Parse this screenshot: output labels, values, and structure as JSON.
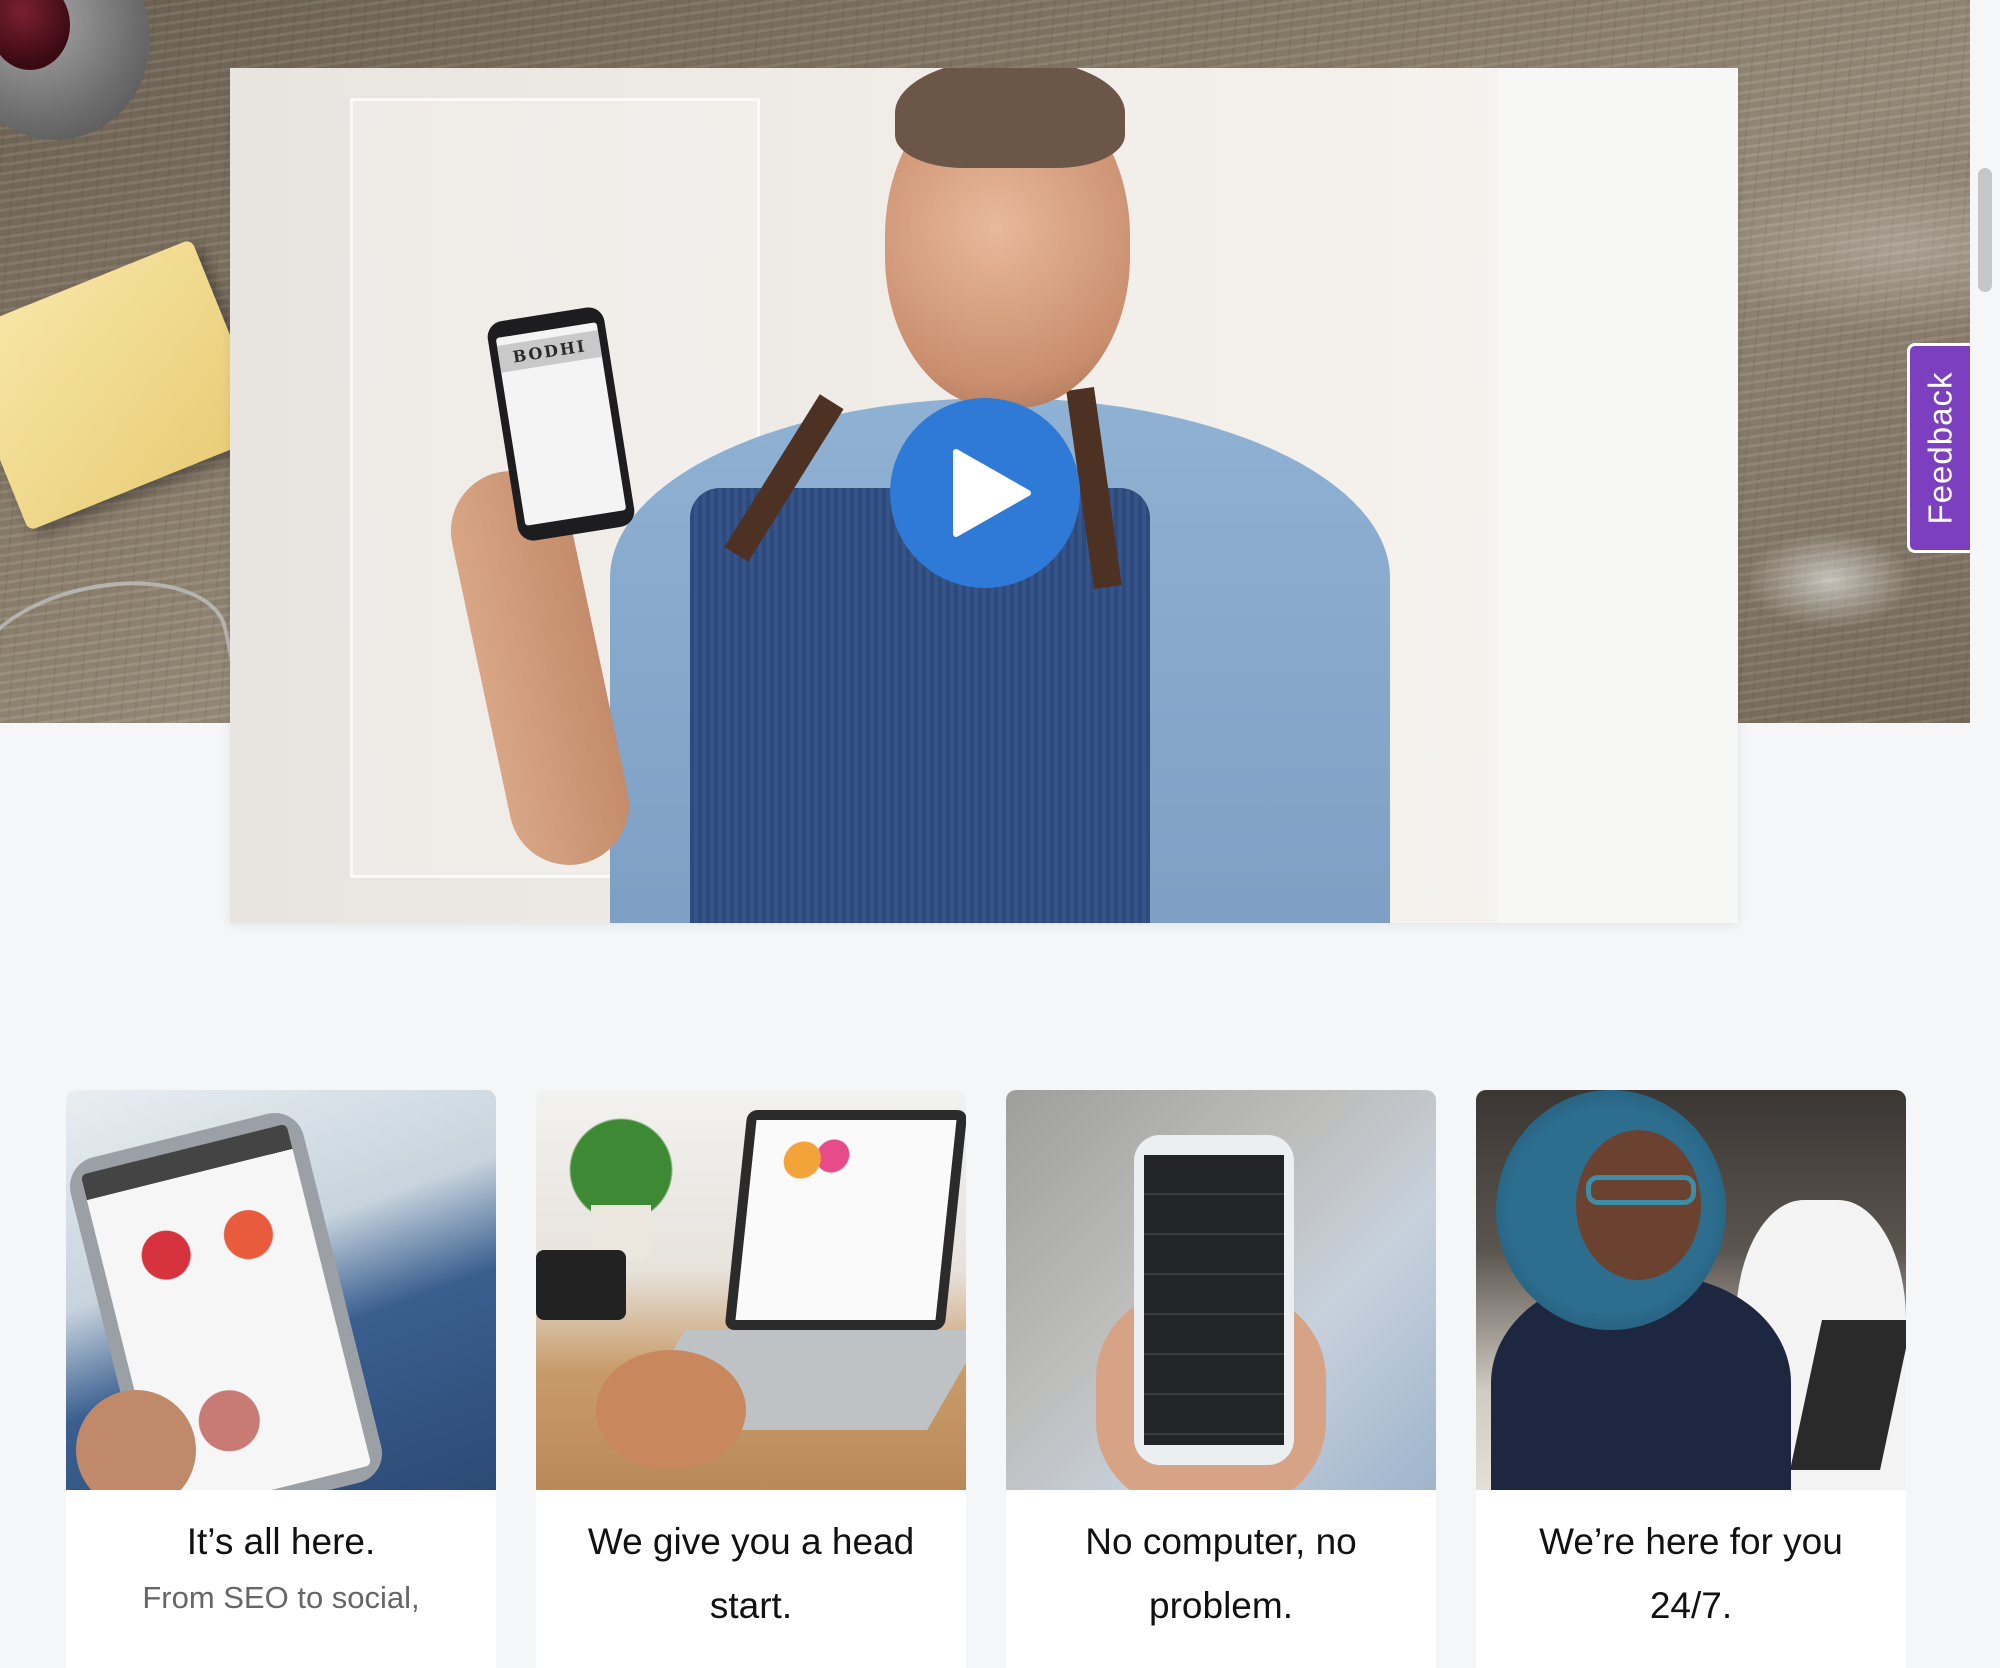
{
  "video": {
    "phone_brand": "BODHI",
    "play_label": "Play video",
    "icon": "play-icon",
    "accent_color": "#2f7ad6"
  },
  "feedback": {
    "label": "Feedback",
    "color": "#7b3fbf"
  },
  "cards": [
    {
      "title": "It’s all here.",
      "subtitle": "From SEO to social,"
    },
    {
      "title": "We give you a head start.",
      "subtitle": ""
    },
    {
      "title": "No computer, no problem.",
      "subtitle": ""
    },
    {
      "title": "We’re here for you 24/7.",
      "subtitle": ""
    }
  ]
}
